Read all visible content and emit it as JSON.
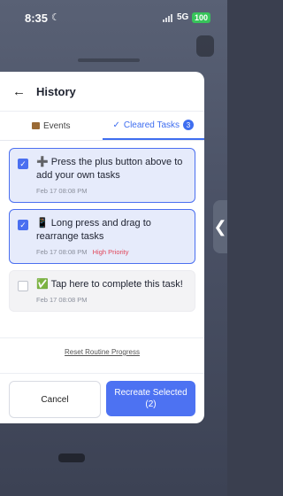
{
  "status_bar": {
    "time": "8:35",
    "network": "5G",
    "battery": "100"
  },
  "header": {
    "title": "History"
  },
  "tabs": [
    {
      "label": "Events",
      "icon": "calendar-icon"
    },
    {
      "label": "Cleared Tasks",
      "icon": "check-icon",
      "count": "3",
      "active": true
    }
  ],
  "tasks": [
    {
      "emoji": "➕",
      "text": "Press the plus button above to add your own tasks",
      "date": "Feb 17 08:08 PM",
      "priority": "",
      "checked": true
    },
    {
      "emoji": "📱",
      "text": "Long press and drag to rearrange tasks",
      "date": "Feb 17 08:08 PM",
      "priority": "High Priority",
      "checked": true
    },
    {
      "emoji": "✅",
      "text": "Tap here to complete this task!",
      "date": "Feb 17 08:08 PM",
      "priority": "",
      "checked": false
    }
  ],
  "reset_link": "Reset Routine Progress",
  "buttons": {
    "cancel": "Cancel",
    "recreate": "Recreate Selected",
    "recreate_count": "(2)"
  },
  "colors": {
    "accent": "#4d72f2",
    "priority": "#e0465a"
  }
}
